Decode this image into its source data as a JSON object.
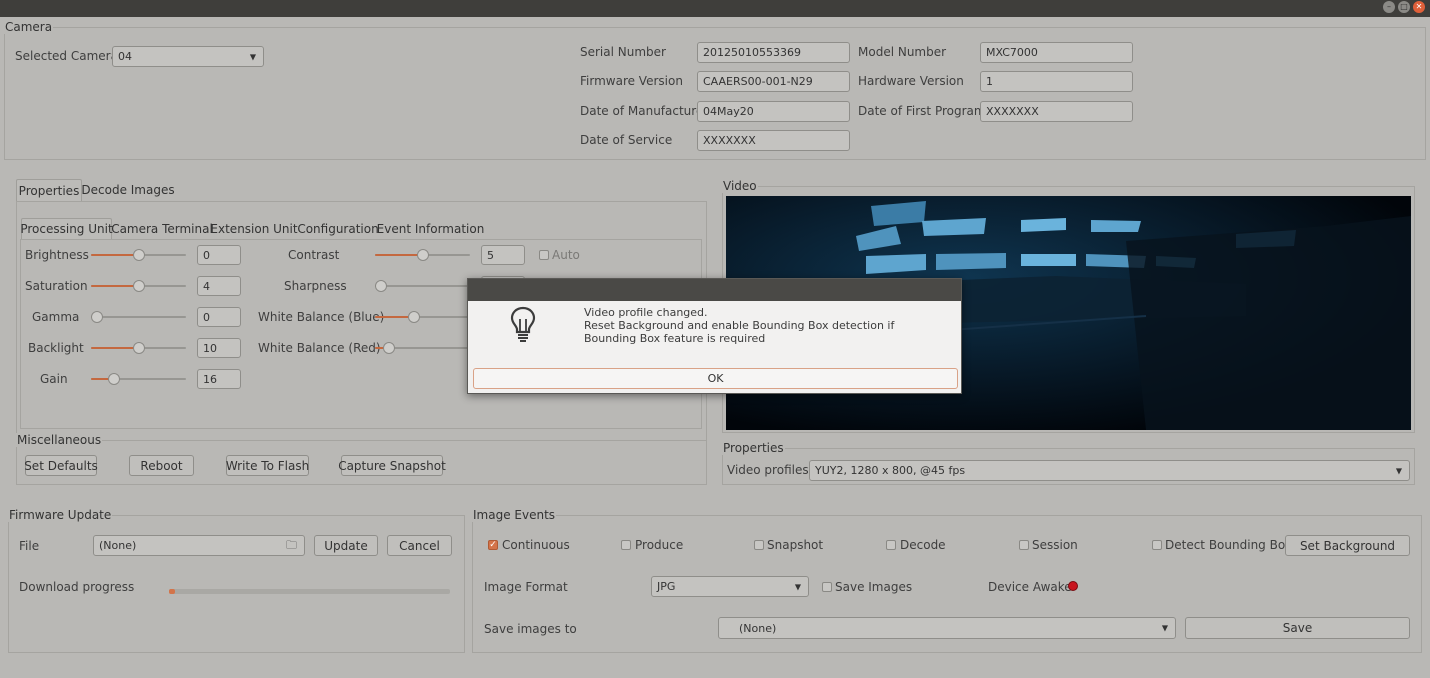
{
  "window": {
    "controls": [
      "–",
      "□",
      "✕"
    ]
  },
  "camera": {
    "group_title": "Camera",
    "selected_label": "Selected Camera",
    "selected_value": "04",
    "info": [
      {
        "label": "Serial Number",
        "value": "20125010553369"
      },
      {
        "label": "Firmware Version",
        "value": "CAAERS00-001-N29"
      },
      {
        "label": "Date of Manufacture",
        "value": "04May20"
      },
      {
        "label": "Date of Service",
        "value": "XXXXXXX"
      },
      {
        "label": "Model Number",
        "value": "MXC7000"
      },
      {
        "label": "Hardware Version",
        "value": "1"
      },
      {
        "label": "Date of First Program",
        "value": "XXXXXXX"
      }
    ]
  },
  "main_tabs": [
    "Properties",
    "Decode Images"
  ],
  "sub_tabs": [
    "Processing Unit",
    "Camera Terminal",
    "Extension Unit",
    "Configuration",
    "Event Information"
  ],
  "controls_left": [
    {
      "label": "Brightness",
      "value": "0",
      "level": 0.5
    },
    {
      "label": "Saturation",
      "value": "4",
      "level": 0.5
    },
    {
      "label": "Gamma",
      "value": "0",
      "level": 0.0
    },
    {
      "label": "Backlight",
      "value": "10",
      "level": 0.5
    },
    {
      "label": "Gain",
      "value": "16",
      "level": 0.2
    }
  ],
  "controls_right": [
    {
      "label": "Contrast",
      "value": "5",
      "level": 0.5
    },
    {
      "label": "Sharpness",
      "value": "",
      "level": 0.0
    },
    {
      "label": "White Balance (Blue)",
      "value": "",
      "level": 0.4
    },
    {
      "label": "White Balance (Red)",
      "value": "",
      "level": 0.1
    }
  ],
  "auto_label": "Auto",
  "misc": {
    "title": "Miscellaneous",
    "buttons": [
      "Set Defaults",
      "Reboot",
      "Write To Flash",
      "Capture Snapshot"
    ]
  },
  "video": {
    "title": "Video"
  },
  "video_properties": {
    "title": "Properties",
    "profiles_label": "Video profiles",
    "profiles_value": "YUY2, 1280 x 800, @45 fps"
  },
  "firmware": {
    "title": "Firmware Update",
    "file_label": "File",
    "file_value": "(None)",
    "update_button": "Update",
    "cancel_button": "Cancel",
    "progress_label": "Download progress",
    "progress": 0.01
  },
  "image_events": {
    "title": "Image Events",
    "checkboxes": [
      {
        "label": "Continuous",
        "checked": true
      },
      {
        "label": "Produce",
        "checked": false
      },
      {
        "label": "Snapshot",
        "checked": false
      },
      {
        "label": "Decode",
        "checked": false
      },
      {
        "label": "Session",
        "checked": false
      },
      {
        "label": "Detect Bounding Box",
        "checked": false
      }
    ],
    "set_background_button": "Set Background",
    "format_label": "Image Format",
    "format_value": "JPG",
    "save_images_label": "Save Images",
    "device_awake_label": "Device Awake",
    "save_to_label": "Save images to",
    "save_to_value": "(None)",
    "save_button": "Save"
  },
  "dialog": {
    "line1": "Video profile changed.",
    "line2": "Reset Background and enable Bounding Box detection if Bounding Box feature is required",
    "ok": "OK"
  },
  "colors": {
    "accent": "#d3744a",
    "dialog_bg": "#f2f1f0",
    "status_led": "#c8141e"
  }
}
